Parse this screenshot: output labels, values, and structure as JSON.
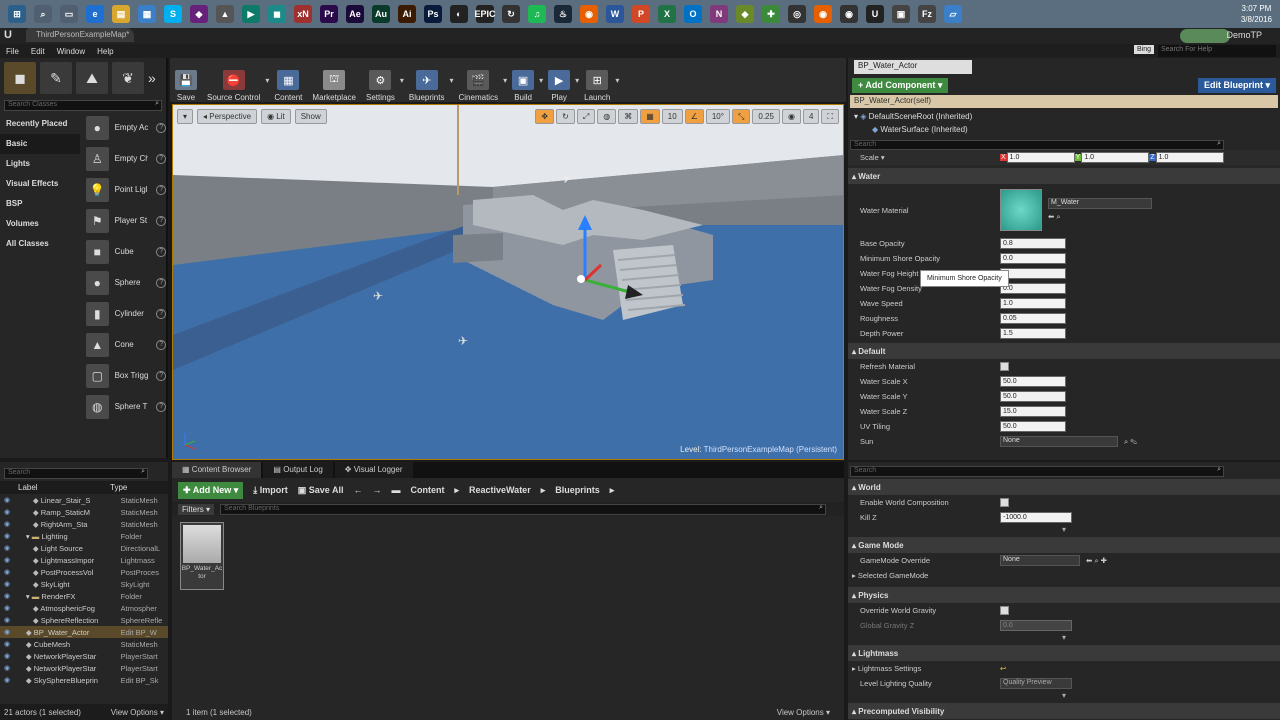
{
  "taskbar": {
    "icons": [
      {
        "name": "windows-start-icon",
        "glyph": "⊞",
        "color": "#2d5f8b"
      },
      {
        "name": "search-icon",
        "glyph": "⌕",
        "color": "#506070"
      },
      {
        "name": "task-view-icon",
        "glyph": "▭",
        "color": "#506070"
      },
      {
        "name": "edge-icon",
        "glyph": "e",
        "color": "#1f6fd1"
      },
      {
        "name": "file-explorer-icon",
        "glyph": "▤",
        "color": "#d8a72e"
      },
      {
        "name": "store-icon",
        "glyph": "▦",
        "color": "#3a7fc7"
      },
      {
        "name": "skype-icon",
        "glyph": "S",
        "color": "#00aff0"
      },
      {
        "name": "visual-studio-icon",
        "glyph": "◆",
        "color": "#68217a"
      },
      {
        "name": "app-icon",
        "glyph": "▲",
        "color": "#555"
      },
      {
        "name": "app-icon",
        "glyph": "▶",
        "color": "#0d7a6a"
      },
      {
        "name": "app-icon",
        "glyph": "◼",
        "color": "#1d8a8a"
      },
      {
        "name": "xn-icon",
        "glyph": "xN",
        "color": "#a03030"
      },
      {
        "name": "premiere-icon",
        "glyph": "Pr",
        "color": "#2a0a4a"
      },
      {
        "name": "after-effects-icon",
        "glyph": "Ae",
        "color": "#1a0a3a"
      },
      {
        "name": "audition-icon",
        "glyph": "Au",
        "color": "#0a3a2a"
      },
      {
        "name": "illustrator-icon",
        "glyph": "Ai",
        "color": "#3a1a00"
      },
      {
        "name": "photoshop-icon",
        "glyph": "Ps",
        "color": "#0a1a3a"
      },
      {
        "name": "app-icon",
        "glyph": "◐",
        "color": "#222"
      },
      {
        "name": "epic-launcher-icon",
        "glyph": "EPIC",
        "color": "#222"
      },
      {
        "name": "app-icon",
        "glyph": "↻",
        "color": "#333"
      },
      {
        "name": "spotify-icon",
        "glyph": "♫",
        "color": "#1db954"
      },
      {
        "name": "steam-icon",
        "glyph": "♨",
        "color": "#1b2838"
      },
      {
        "name": "firefox-icon",
        "glyph": "◉",
        "color": "#e66000"
      },
      {
        "name": "word-icon",
        "glyph": "W",
        "color": "#2b579a"
      },
      {
        "name": "powerpoint-icon",
        "glyph": "P",
        "color": "#d24726"
      },
      {
        "name": "excel-icon",
        "glyph": "X",
        "color": "#217346"
      },
      {
        "name": "outlook-icon",
        "glyph": "O",
        "color": "#0072c6"
      },
      {
        "name": "onenote-icon",
        "glyph": "N",
        "color": "#80397b"
      },
      {
        "name": "app-icon",
        "glyph": "◆",
        "color": "#6a8a2a"
      },
      {
        "name": "app-icon",
        "glyph": "✚",
        "color": "#3a8a3a"
      },
      {
        "name": "app-icon",
        "glyph": "◎",
        "color": "#333"
      },
      {
        "name": "firefox-icon",
        "glyph": "◉",
        "color": "#e66000"
      },
      {
        "name": "app-icon",
        "glyph": "◉",
        "color": "#333"
      },
      {
        "name": "unreal-icon",
        "glyph": "U",
        "color": "#222"
      },
      {
        "name": "app-icon",
        "glyph": "▣",
        "color": "#444"
      },
      {
        "name": "app-icon",
        "glyph": "Fz",
        "color": "#444"
      },
      {
        "name": "app-icon",
        "glyph": "▱",
        "color": "#3a7fc7"
      }
    ],
    "time": "3:07 PM",
    "date": "3/8/2016"
  },
  "window": {
    "doc_tab": "ThirdPersonExampleMap*",
    "project_name": "DemoTP",
    "search_placeholder": "Search For Help",
    "bing": "Bing"
  },
  "menu": [
    "File",
    "Edit",
    "Window",
    "Help"
  ],
  "modes": {
    "search_placeholder": "Search Classes",
    "categories": [
      "Recently Placed",
      "Basic",
      "Lights",
      "Visual Effects",
      "BSP",
      "Volumes",
      "All Classes"
    ],
    "selected_category": "Basic",
    "items": [
      {
        "label": "Empty Ac",
        "glyph": "●"
      },
      {
        "label": "Empty Ch",
        "glyph": "♙"
      },
      {
        "label": "Point Ligl",
        "glyph": "💡"
      },
      {
        "label": "Player St",
        "glyph": "⚑"
      },
      {
        "label": "Cube",
        "glyph": "■"
      },
      {
        "label": "Sphere",
        "glyph": "●"
      },
      {
        "label": "Cylinder",
        "glyph": "▮"
      },
      {
        "label": "Cone",
        "glyph": "▲"
      },
      {
        "label": "Box Trigg",
        "glyph": "▢"
      },
      {
        "label": "Sphere T",
        "glyph": "◍"
      }
    ]
  },
  "toolbar": [
    {
      "label": "Save",
      "glyph": "💾",
      "color": "#6a7a8a"
    },
    {
      "label": "Source Control",
      "glyph": "⛔",
      "color": "#8a3a3a"
    },
    {
      "label": "Content",
      "glyph": "▦",
      "color": "#4a6a9a"
    },
    {
      "label": "Marketplace",
      "glyph": "⛫",
      "color": "#8a8a8a"
    },
    {
      "label": "Settings",
      "glyph": "⚙",
      "color": "#5a5a5a"
    },
    {
      "label": "Blueprints",
      "glyph": "✈",
      "color": "#4a6a9a"
    },
    {
      "label": "Cinematics",
      "glyph": "🎬",
      "color": "#5a5a5a"
    },
    {
      "label": "Build",
      "glyph": "▣",
      "color": "#4a6a9a"
    },
    {
      "label": "Play",
      "glyph": "▶",
      "color": "#4a6a9a"
    },
    {
      "label": "Launch",
      "glyph": "⊞",
      "color": "#5a5a5a"
    }
  ],
  "viewport": {
    "perspective": "Perspective",
    "lit": "Lit",
    "show": "Show",
    "grid_snap": "10",
    "rot_snap": "10°",
    "scale_snap": "0.25",
    "cam_speed": "4",
    "level_prefix": "Level:",
    "level_name": "ThirdPersonExampleMap (Persistent)"
  },
  "details": {
    "actor_name": "BP_Water_Actor",
    "add_component": "+ Add Component ▾",
    "edit_blueprint": "Edit Blueprint ▾",
    "self_row": "BP_Water_Actor(self)",
    "tree": [
      "DefaultSceneRoot (Inherited)",
      "WaterSurface (Inherited)"
    ],
    "search_placeholder": "Search",
    "scale_label": "Scale ▾",
    "scale": {
      "x": "1.0",
      "y": "1.0",
      "z": "1.0"
    },
    "water_section": "Water",
    "water_material_label": "Water Material",
    "water_material": "M_Water",
    "water_props": [
      {
        "k": "Base Opacity",
        "v": "0.8"
      },
      {
        "k": "Minimum Shore Opacity",
        "v": "0.0"
      },
      {
        "k": "Water Fog Height",
        "v": ""
      },
      {
        "k": "Water Fog Density",
        "v": "0.0"
      },
      {
        "k": "Wave Speed",
        "v": "1.0"
      },
      {
        "k": "Roughness",
        "v": "0.05"
      },
      {
        "k": "Depth Power",
        "v": "1.5"
      }
    ],
    "tooltip": "Minimum Shore Opacity",
    "default_section": "Default",
    "refresh_material": "Refresh Material",
    "default_props": [
      {
        "k": "Water Scale X",
        "v": "50.0"
      },
      {
        "k": "Water Scale Y",
        "v": "50.0"
      },
      {
        "k": "Water Scale Z",
        "v": "15.0"
      },
      {
        "k": "UV Tiling",
        "v": "50.0"
      }
    ],
    "sun_label": "Sun",
    "sun_value": "None"
  },
  "outliner": {
    "search_placeholder": "Search",
    "col_label": "Label",
    "col_type": "Type",
    "rows": [
      {
        "n": "Linear_Stair_S",
        "t": "StaticMesh",
        "indent": 3,
        "folder": false,
        "sel": false
      },
      {
        "n": "Ramp_StaticM",
        "t": "StaticMesh",
        "indent": 3,
        "folder": false,
        "sel": false
      },
      {
        "n": "RightArm_Sta",
        "t": "StaticMesh",
        "indent": 3,
        "folder": false,
        "sel": false
      },
      {
        "n": "Lighting",
        "t": "Folder",
        "indent": 2,
        "folder": true,
        "sel": false
      },
      {
        "n": "Light Source",
        "t": "DirectionalL",
        "indent": 3,
        "folder": false,
        "sel": false
      },
      {
        "n": "LightmassImpor",
        "t": "Lightmass",
        "indent": 3,
        "folder": false,
        "sel": false
      },
      {
        "n": "PostProcessVol",
        "t": "PostProces",
        "indent": 3,
        "folder": false,
        "sel": false
      },
      {
        "n": "SkyLight",
        "t": "SkyLight",
        "indent": 3,
        "folder": false,
        "sel": false
      },
      {
        "n": "RenderFX",
        "t": "Folder",
        "indent": 2,
        "folder": true,
        "sel": false
      },
      {
        "n": "AtmosphericFog",
        "t": "Atmospher",
        "indent": 3,
        "folder": false,
        "sel": false
      },
      {
        "n": "SphereReflection",
        "t": "SphereRefle",
        "indent": 3,
        "folder": false,
        "sel": false
      },
      {
        "n": "BP_Water_Actor",
        "t": "Edit BP_W",
        "indent": 2,
        "folder": false,
        "sel": true
      },
      {
        "n": "CubeMesh",
        "t": "StaticMesh",
        "indent": 2,
        "folder": false,
        "sel": false
      },
      {
        "n": "NetworkPlayerStar",
        "t": "PlayerStart",
        "indent": 2,
        "folder": false,
        "sel": false
      },
      {
        "n": "NetworkPlayerStar",
        "t": "PlayerStart",
        "indent": 2,
        "folder": false,
        "sel": false
      },
      {
        "n": "SkySphereBlueprin",
        "t": "Edit BP_Sk",
        "indent": 2,
        "folder": false,
        "sel": false
      }
    ],
    "status": "21 actors (1 selected)",
    "view_options": "View Options ▾"
  },
  "content_browser": {
    "tabs": [
      "Content Browser",
      "Output Log",
      "Visual Logger"
    ],
    "add_new": "Add New ▾",
    "import": "Import",
    "save_all": "Save All",
    "path": [
      "Content",
      "ReactiveWater",
      "Blueprints"
    ],
    "filters": "Filters ▾",
    "search_placeholder": "Search Blueprints",
    "asset": "BP_Water_Actor",
    "status": "1 item (1 selected)",
    "view_options": "View Options ▾"
  },
  "world_settings": {
    "search_placeholder": "Search",
    "world": "World",
    "enable_world_comp": "Enable World Composition",
    "kill_z_label": "Kill Z",
    "kill_z": "-1000.0",
    "game_mode": "Game Mode",
    "gm_override": "GameMode Override",
    "gm_value": "None",
    "selected_gm": "Selected GameMode",
    "physics": "Physics",
    "override_gravity": "Override World Gravity",
    "global_gravity": "Global Gravity Z",
    "global_gravity_v": "0.0",
    "lightmass": "Lightmass",
    "lightmass_settings": "Lightmass Settings",
    "lighting_quality": "Level Lighting Quality",
    "lighting_quality_v": "Quality Preview",
    "precomputed": "Precomputed Visibility"
  }
}
